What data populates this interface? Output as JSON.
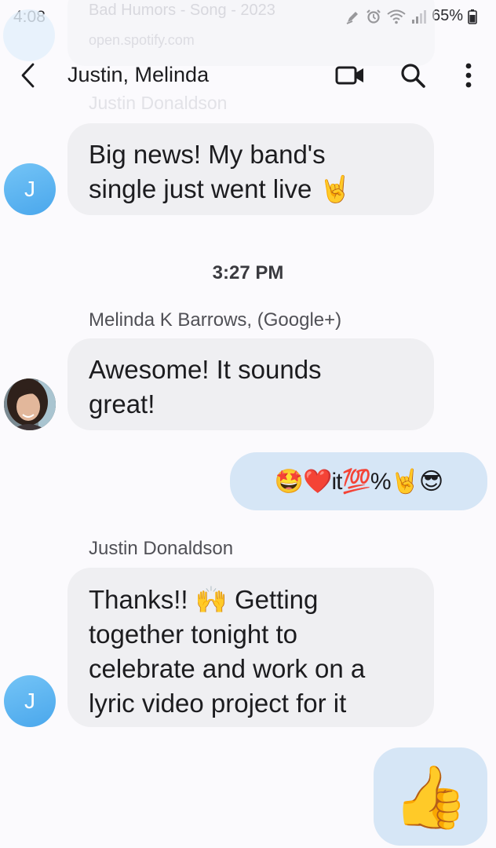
{
  "status_bar": {
    "time": "4:08",
    "battery": "65%"
  },
  "preview": {
    "title": "Bad Humors - Song - 2023",
    "url": "open.spotify.com",
    "sender": "Justin Donaldson",
    "avatar_letter": "J"
  },
  "header": {
    "title": "Justin, Melinda",
    "icons": [
      "back-arrow-icon",
      "video-call-icon",
      "search-icon",
      "more-options-icon"
    ]
  },
  "conversation": {
    "message_1": {
      "sender_initial": "J",
      "lines": [
        "Big news! My band's",
        "single just went live 🤘"
      ]
    },
    "time_divider": "3:27 PM",
    "message_2": {
      "sender": "Melinda K Barrows, (Google+)",
      "lines": [
        "Awesome!  It sounds",
        "great!"
      ]
    },
    "message_3": {
      "text": "🤩❤️it💯%🤘😎"
    },
    "message_4": {
      "sender": "Justin Donaldson",
      "sender_initial": "J",
      "lines": [
        "Thanks!! 🙌 Getting",
        "together tonight to",
        "celebrate and work on a",
        "lyric video project for it"
      ]
    },
    "message_5": {
      "text": "👍"
    }
  },
  "colors": {
    "background": "#fbfafd",
    "incoming_bubble": "#efeff2",
    "outgoing_bubble": "#d6e6f6",
    "avatar_blue": "#5ab3f0"
  }
}
